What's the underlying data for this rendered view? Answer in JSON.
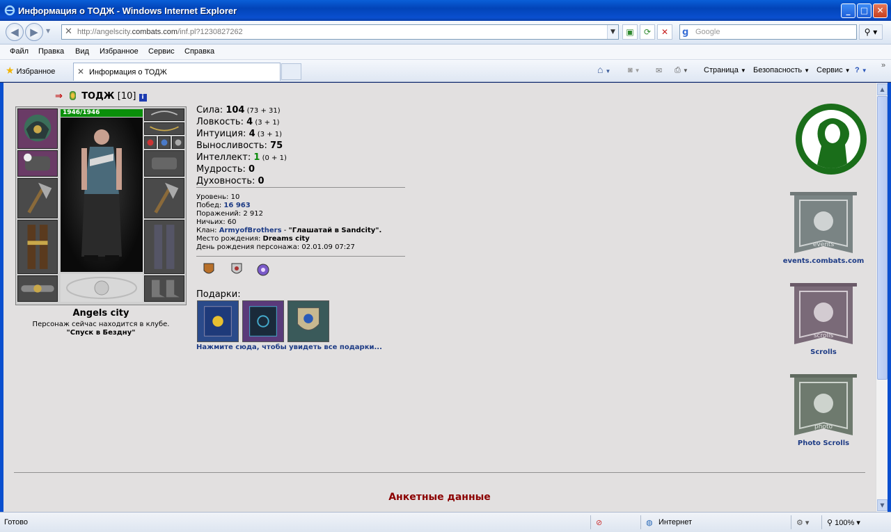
{
  "window": {
    "title": "Информация о ТОДЖ - Windows Internet Explorer"
  },
  "nav": {
    "url_prefix": "http://angelscity.",
    "url_host": "combats.com",
    "url_suffix": "/inf.pl?1230827262",
    "search_placeholder": "Google"
  },
  "menu": {
    "items": [
      "Файл",
      "Правка",
      "Вид",
      "Избранное",
      "Сервис",
      "Справка"
    ]
  },
  "tabs": {
    "favorites_label": "Избранное",
    "active_tab": "Информация о ТОДЖ",
    "cmd_page": "Страница",
    "cmd_security": "Безопасность",
    "cmd_tools": "Сервис"
  },
  "character": {
    "nick": "ТОДЖ",
    "level_badge": "[10]",
    "hp": "1946/1946",
    "city": "Angels city",
    "club_status": "Персонаж сейчас находится в клубе.",
    "club_location": "\"Спуск в Бездну\""
  },
  "stats": [
    {
      "label": "Сила: ",
      "value": "104",
      "detail": " (73 + 31)",
      "green": false
    },
    {
      "label": "Ловкость: ",
      "value": "4",
      "detail": " (3 + 1)",
      "green": false
    },
    {
      "label": "Интуиция: ",
      "value": "4",
      "detail": " (3 + 1)",
      "green": false
    },
    {
      "label": "Выносливость: ",
      "value": "75",
      "detail": "",
      "green": false
    },
    {
      "label": "Интеллект: ",
      "value": "1",
      "detail": " (0 + 1)",
      "green": true
    },
    {
      "label": "Мудрость: ",
      "value": "0",
      "detail": "",
      "green": false
    },
    {
      "label": "Духовность: ",
      "value": "0",
      "detail": "",
      "green": false
    }
  ],
  "details": {
    "level_label": "Уровень: ",
    "level": "10",
    "wins_label": "Побед: ",
    "wins": "16 963",
    "losses_label": "Поражений: ",
    "losses": "2 912",
    "draws_label": "Ничьих: ",
    "draws": "60",
    "clan_label": "Клан: ",
    "clan": "ArmyofBrothers",
    "clan_sep": " - ",
    "clan_title": "\"Глашатай в Sandcity\".",
    "birthplace_label": "Место рождения: ",
    "birthplace": "Dreams city",
    "birthday_label": "День рождения персонажа: ",
    "birthday": "02.01.09 07:27"
  },
  "gifts": {
    "label": "Подарки:",
    "link": "Нажмите сюда, чтобы увидеть все подарки..."
  },
  "sidebar": {
    "events": "events.combats.com",
    "scrolls": "Scrolls",
    "photo": "Photo Scrolls",
    "banner_events_text": "events",
    "banner_scrolls_text": "scrolls",
    "banner_photo_text": "photo"
  },
  "section": {
    "title": "Анкетные данные"
  },
  "status": {
    "ready": "Готово",
    "zone": "Интернет",
    "zoom": "100%"
  },
  "colors": {
    "title_blue": "#0a4fcf",
    "page_bg": "#e2e0e0",
    "link_blue": "#1d3b85",
    "section_red": "#8b0000",
    "hp_green": "#0a8f0a",
    "logo_green": "#1a6e1a"
  }
}
